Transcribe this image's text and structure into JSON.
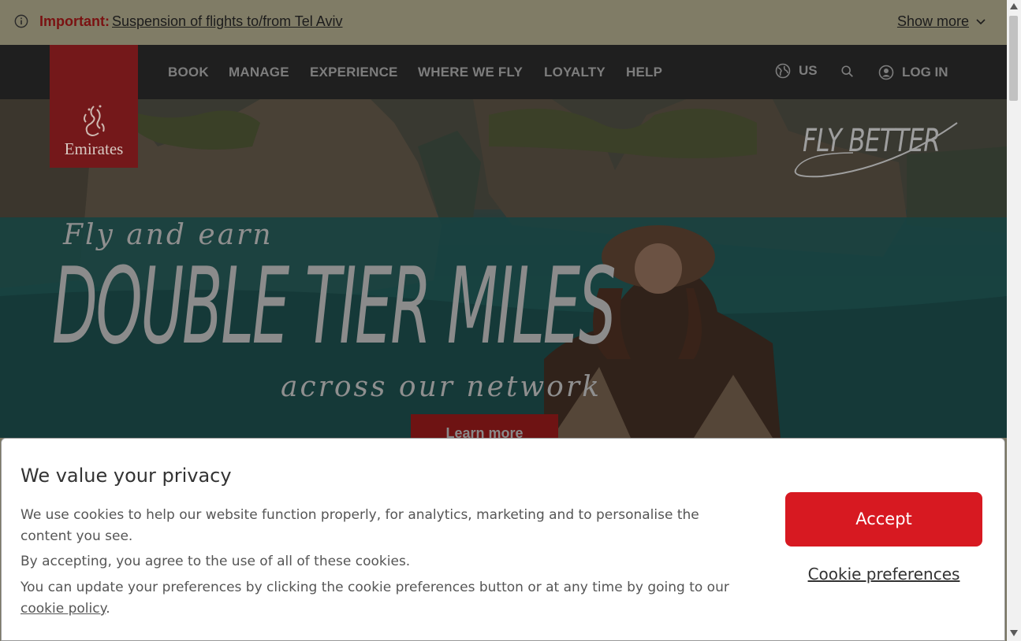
{
  "alert": {
    "icon": "info-circle-icon",
    "prefix": "Important:",
    "message": "Suspension of flights to/from Tel Aviv",
    "show_more": "Show more"
  },
  "nav": {
    "items": [
      "BOOK",
      "MANAGE",
      "EXPERIENCE",
      "WHERE WE FLY",
      "LOYALTY",
      "HELP"
    ],
    "region": "US",
    "login": "LOG IN"
  },
  "logo": {
    "text": "Emirates"
  },
  "hero": {
    "brand_tag": "FLY BETTER",
    "subtitle": "Fly and earn",
    "title": "DOUBLE TIER MILES",
    "tagline": "across our network",
    "cta": "Learn more"
  },
  "cookie": {
    "title": "We value your privacy",
    "p1": "We use cookies to help our website function properly, for analytics, marketing and to personalise the content you see.",
    "p2": "By accepting, you agree to the use of all of these cookies.",
    "p3_text": "You can update your preferences by clicking the cookie preferences button or at any time by going to our ",
    "p3_link": "cookie policy",
    "p3_end": ".",
    "accept": "Accept",
    "preferences": "Cookie preferences"
  },
  "colors": {
    "accent": "#d71921",
    "overlay_alert": "#807c66",
    "nav_bg": "#1f1f1f",
    "logo_bg": "#74181a"
  }
}
